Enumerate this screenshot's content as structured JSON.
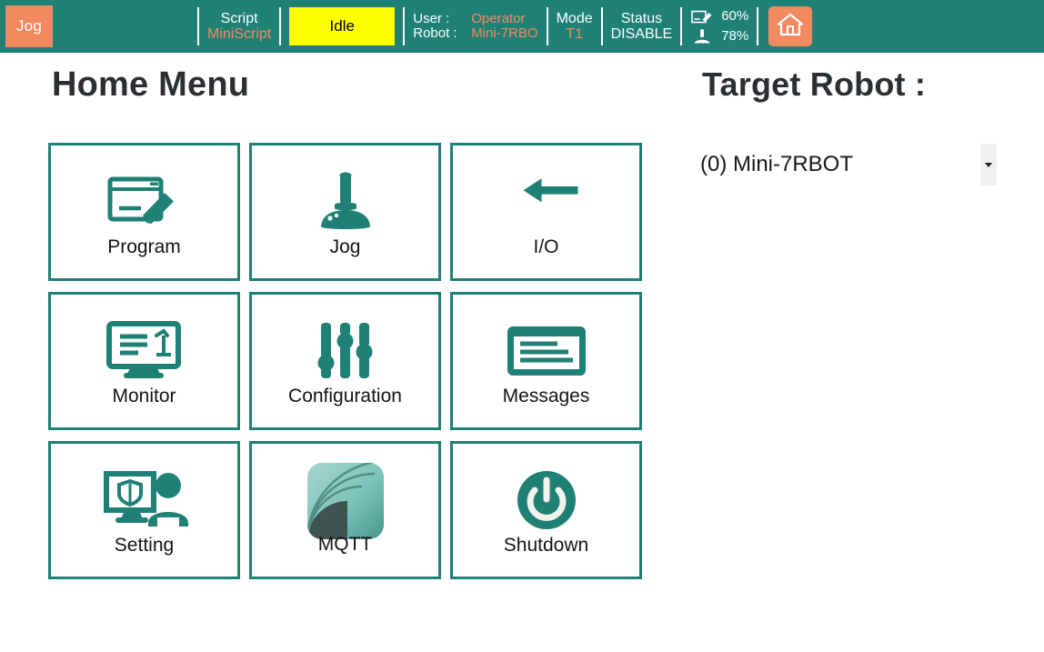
{
  "header": {
    "mode_badge": "Jog",
    "script": {
      "label": "Script",
      "value": "MiniScript"
    },
    "state_box": "Idle",
    "user": {
      "label": "User :",
      "value": "Operator"
    },
    "robot": {
      "label": "Robot :",
      "value": "Mini-7RBO"
    },
    "mode": {
      "label": "Mode",
      "value": "T1"
    },
    "status": {
      "label": "Status",
      "value": "DISABLE"
    },
    "program_percent": "60%",
    "jog_percent": "78%",
    "home_icon": "home-icon",
    "colors": {
      "teal": "#1f8076",
      "orange": "#f2895f",
      "yellow": "#ffff00"
    }
  },
  "main": {
    "page_title": "Home Menu",
    "target_robot_title": "Target Robot :",
    "target_robot_selected": "(0) Mini-7RBOT",
    "tiles": [
      {
        "label": "Program",
        "icon": "program-pencil-icon"
      },
      {
        "label": "Jog",
        "icon": "joystick-icon"
      },
      {
        "label": "I/O",
        "icon": "io-arrows-icon"
      },
      {
        "label": "Monitor",
        "icon": "monitor-robot-icon"
      },
      {
        "label": "Configuration",
        "icon": "sliders-icon"
      },
      {
        "label": "Messages",
        "icon": "message-box-icon"
      },
      {
        "label": "Setting",
        "icon": "shield-user-icon"
      },
      {
        "label": "MQTT",
        "icon": "mqtt-logo-icon"
      },
      {
        "label": "Shutdown",
        "icon": "power-icon"
      }
    ]
  }
}
